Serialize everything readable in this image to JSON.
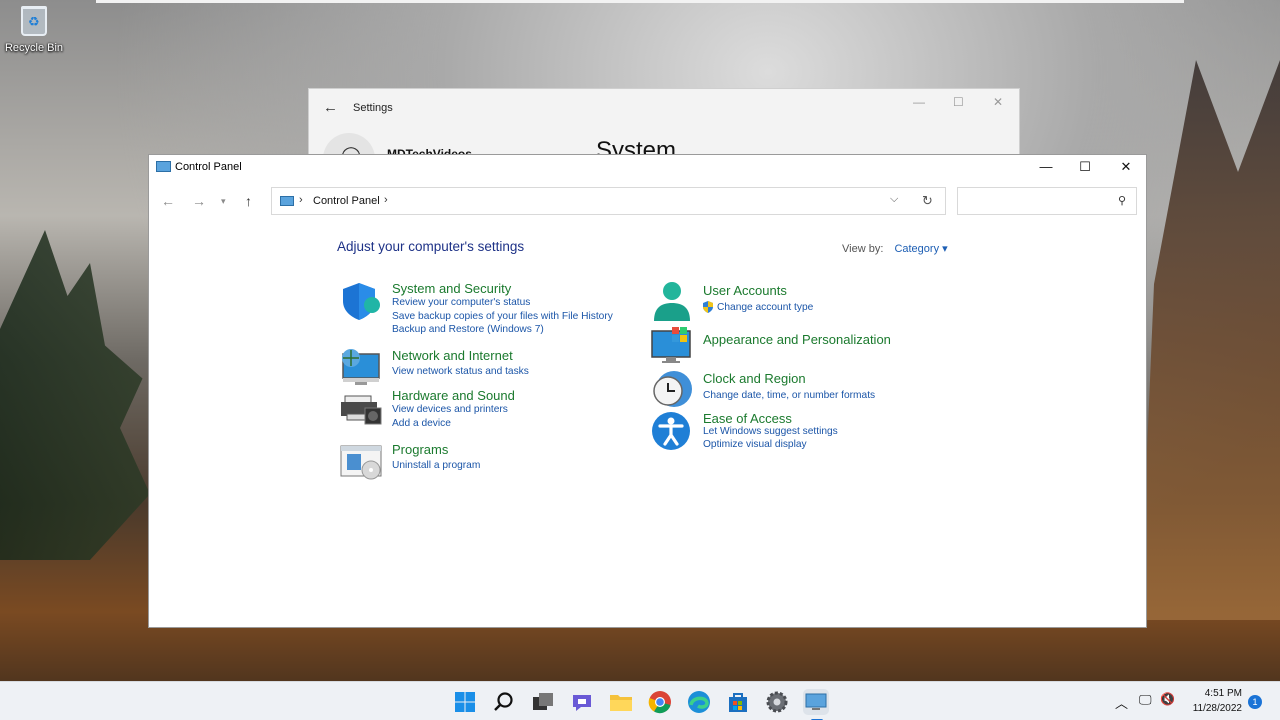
{
  "desktop": {
    "recycle_bin_label": "Recycle Bin"
  },
  "settings_window": {
    "title": "Settings",
    "user_name": "MDTechVideos",
    "section_title": "System"
  },
  "control_panel": {
    "title": "Control Panel",
    "breadcrumb": "Control Panel",
    "search_placeholder": "",
    "heading": "Adjust your computer's settings",
    "view_by_label": "View by:",
    "view_by_value": "Category",
    "left_categories": [
      {
        "title": "System and Security",
        "icon": "shield-icon",
        "links": [
          "Review your computer's status",
          "Save backup copies of your files with File History",
          "Backup and Restore (Windows 7)"
        ]
      },
      {
        "title": "Network and Internet",
        "icon": "network-globe-icon",
        "links": [
          "View network status and tasks"
        ]
      },
      {
        "title": "Hardware and Sound",
        "icon": "printer-icon",
        "links": [
          "View devices and printers",
          "Add a device"
        ]
      },
      {
        "title": "Programs",
        "icon": "programs-icon",
        "links": [
          "Uninstall a program"
        ]
      }
    ],
    "right_categories": [
      {
        "title": "User Accounts",
        "icon": "user-icon",
        "links": [
          "Change account type"
        ]
      },
      {
        "title": "Appearance and Personalization",
        "icon": "monitor-palette-icon",
        "links": []
      },
      {
        "title": "Clock and Region",
        "icon": "clock-globe-icon",
        "links": [
          "Change date, time, or number formats"
        ]
      },
      {
        "title": "Ease of Access",
        "icon": "accessibility-icon",
        "links": [
          "Let Windows suggest settings",
          "Optimize visual display"
        ]
      }
    ]
  },
  "taskbar": {
    "apps": [
      "start-icon",
      "search-icon",
      "task-view-icon",
      "chat-icon",
      "file-explorer-icon",
      "chrome-icon",
      "edge-icon",
      "store-icon",
      "settings-gear-icon",
      "control-panel-icon"
    ],
    "time": "4:51 PM",
    "date": "11/28/2022",
    "notification_count": "1"
  },
  "colors": {
    "link": "#1c56a8",
    "category_title": "#1b7a2e",
    "heading": "#1e3287"
  }
}
